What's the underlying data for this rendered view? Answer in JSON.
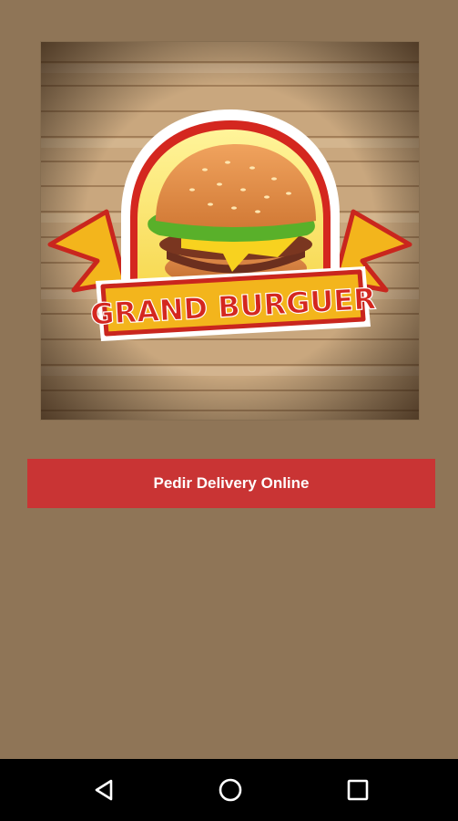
{
  "logo": {
    "brand_text": "GRAND BURGUER"
  },
  "cta": {
    "label": "Pedir Delivery Online"
  },
  "colors": {
    "background": "#8f7557",
    "cta": "#c93434",
    "navbar": "#000000"
  },
  "navbar": {
    "icons": [
      "back-icon",
      "home-icon",
      "recent-apps-icon"
    ]
  }
}
